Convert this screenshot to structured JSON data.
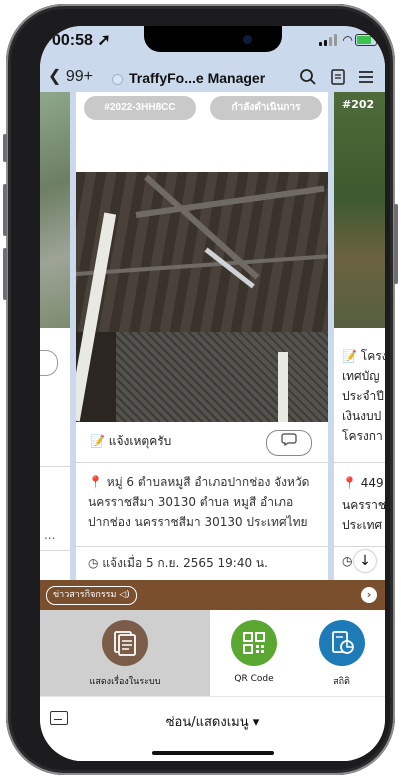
{
  "status": {
    "time": "00:58"
  },
  "nav": {
    "back_count": "99+",
    "title": "TraffyFo...e Manager"
  },
  "cards": {
    "main": {
      "ticket_id": "#2022-3HH8CC",
      "status": "กำลังดำเนินการ",
      "report_label": "แจ้งเหตุครับ",
      "address": "หมู่ 6 ตำบลหมูสี อำเภอปากช่อง จังหวัดนครราชสีมา 30130 ตำบล หมูสี อำเภอปากช่อง นครราชสีมา 30130 ประเทศไทย",
      "reported_at": "แจ้งเมื่อ 5 ก.ย. 2565 19:40 น."
    },
    "right": {
      "ticket_prefix": "#202",
      "lines": [
        "โครง",
        "เทศบัญ",
        "ประจำปี",
        "เงินงบป",
        "โครงกา"
      ],
      "address_start": "449",
      "address_lines": [
        "นครราช",
        "ประเทศ"
      ]
    },
    "left": {
      "address_end": "..."
    }
  },
  "news": {
    "label": "ข่าวสารกิจกรรม"
  },
  "menu": [
    {
      "label": "แสดงเรื่องในระบบ",
      "icon": "documents-icon",
      "color": "#7a5c48"
    },
    {
      "label": "QR Code",
      "icon": "qr-code-icon",
      "color": "#5aa832"
    },
    {
      "label": "สถิติ",
      "icon": "statistics-icon",
      "color": "#1f7ab8"
    }
  ],
  "bottom": {
    "toggle_menu": "ซ่อน/แสดงเมนู ▾"
  }
}
